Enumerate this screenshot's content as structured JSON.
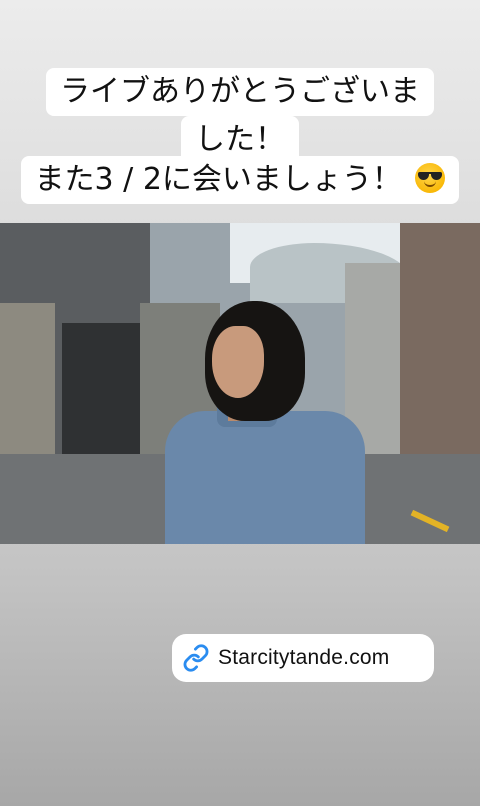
{
  "caption": {
    "line1": "ライブありがとうございま",
    "line2": "した！",
    "line3": "また3 / 2に会いましょう！",
    "emoji": "smiling-face-with-sunglasses"
  },
  "photo": {
    "subject": "photo-man-in-denim-shirt"
  },
  "link_sticker": {
    "icon": "link-icon",
    "text": "Starcitytande.com",
    "icon_color": "#2a8cf0"
  },
  "colors": {
    "caption_bg": "#ffffff",
    "caption_text": "#111111"
  }
}
